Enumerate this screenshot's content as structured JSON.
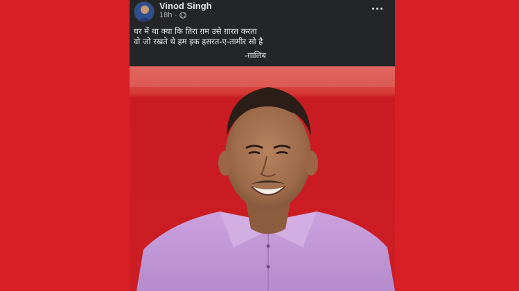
{
  "post": {
    "author": "Vinod Singh",
    "timestamp": "18h",
    "separator": "·",
    "privacy_icon": "globe-icon",
    "more_icon": "more-options-icon",
    "text_lines": [
      "घर में था क्या कि तिरा ग़म उसे ग़ारत करता",
      "वो जो रखते थे हम इक हसरत-ए-तामीर सो है"
    ],
    "signature": "-ग़ालिब",
    "photo_icon": "person-photo"
  },
  "colors": {
    "background": "#d81f26",
    "post_background": "#242526",
    "text_primary": "#e4e6eb",
    "text_secondary": "#b0b3b8"
  }
}
